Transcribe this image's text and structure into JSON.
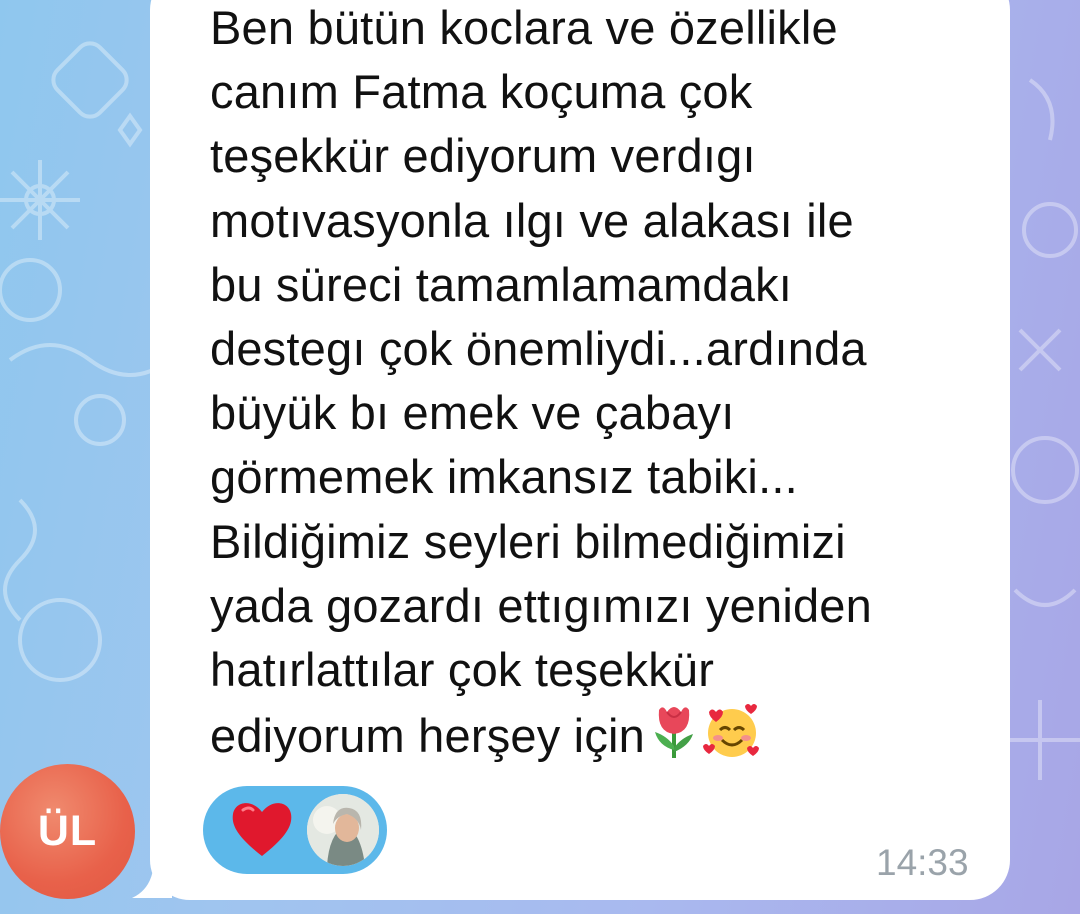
{
  "message": {
    "lines": [
      "Ben bütün koclara ve özellikle",
      "canım Fatma koçuma çok",
      "teşekkür ediyorum verdıgı",
      "motıvasyonla ılgı ve alakası ile",
      "bu süreci tamamlamamdakı",
      "destegı çok önemliydi...ardında",
      "büyük bı emek ve çabayı",
      "görmemek imkansız tabiki...",
      "Bildiğimiz seyleri bilmediğimizi",
      "yada gozardı ettıgımızı yeniden",
      "hatırlattılar çok teşekkür"
    ],
    "last_line": "ediyorum herşey için",
    "emojis": [
      "tulip-emoji",
      "smiling-face-with-hearts-emoji"
    ],
    "time": "14:33"
  },
  "sender": {
    "initials": "ÜL",
    "avatar_color": "#e8614a"
  },
  "reaction": {
    "icon": "red-heart-emoji",
    "pill_color": "#5cb8ea",
    "reactor_avatar": "user-photo-avatar"
  },
  "theme": {
    "bubble_color": "#ffffff",
    "text_color": "#111111",
    "time_color": "#9aa3aa"
  }
}
